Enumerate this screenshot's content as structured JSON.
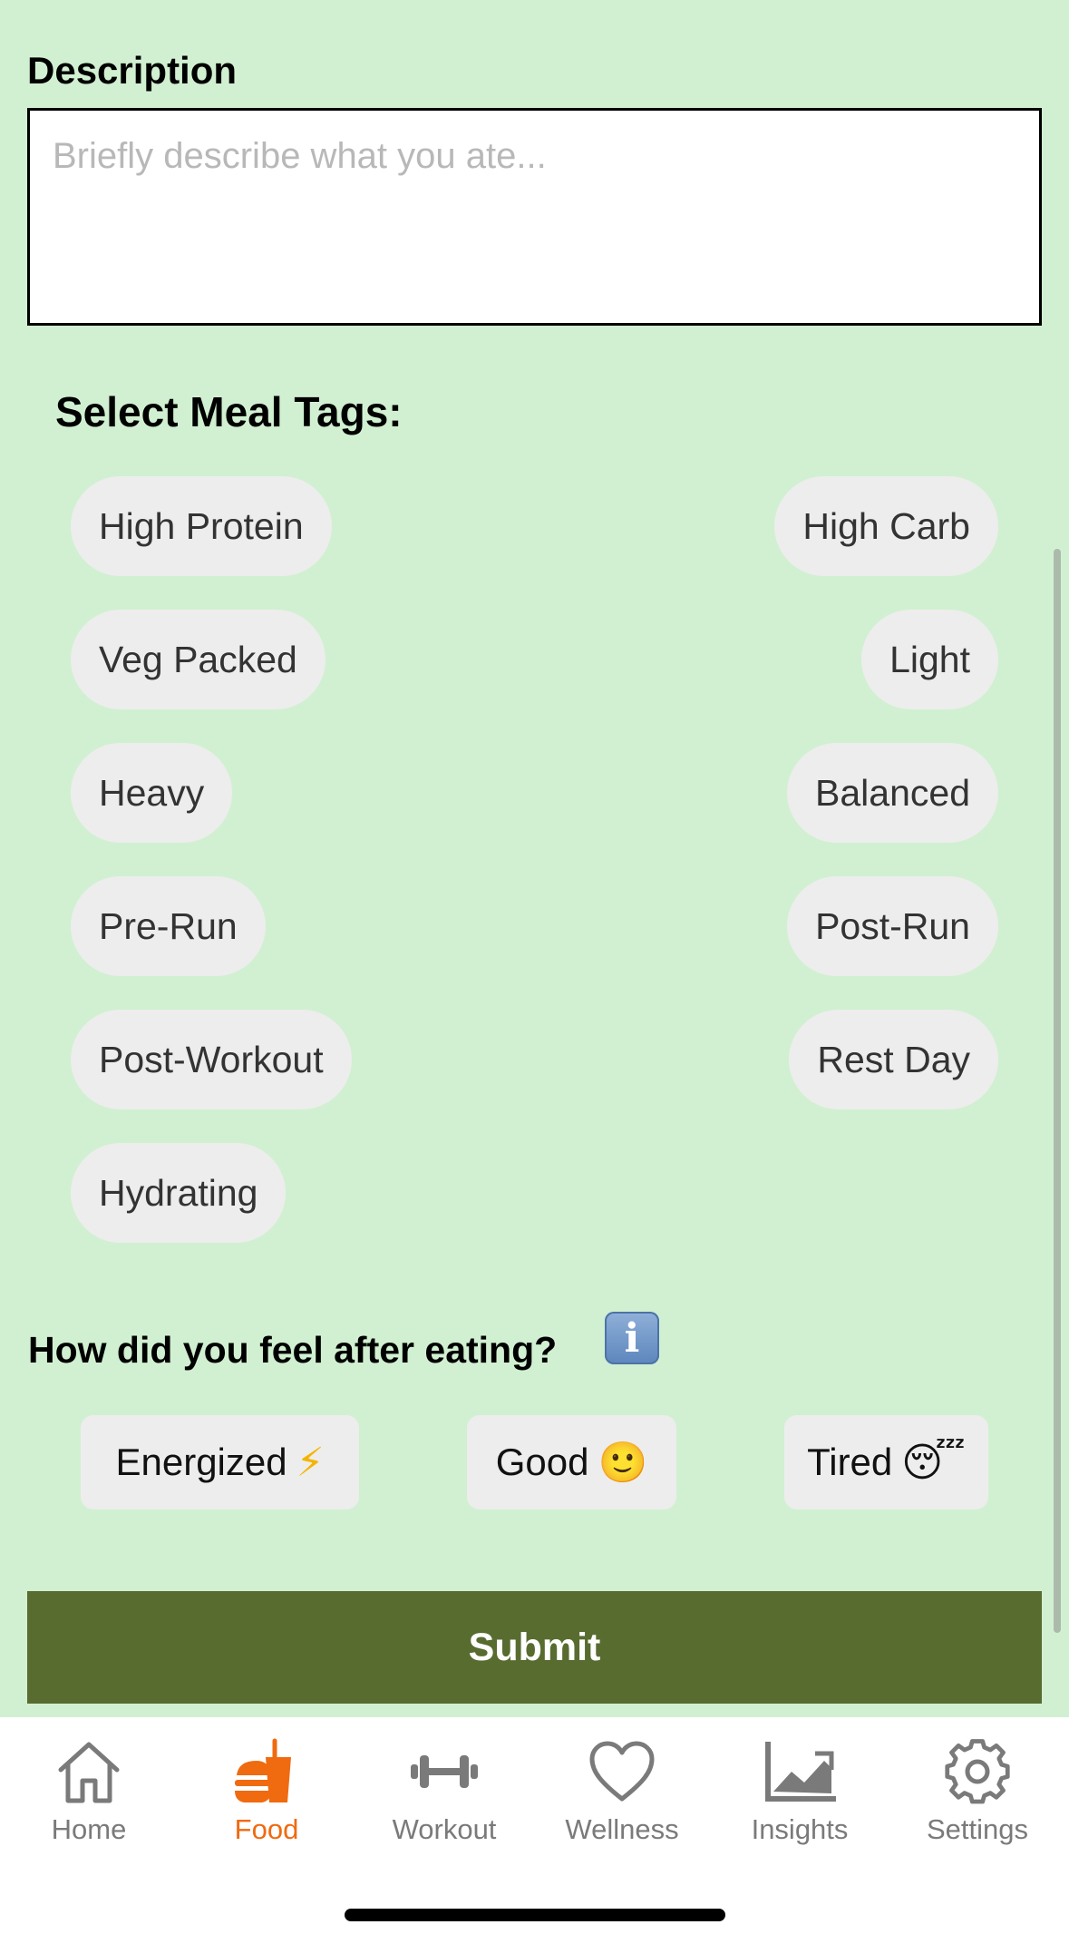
{
  "description": {
    "label": "Description",
    "placeholder": "Briefly describe what you ate..."
  },
  "meal_tags": {
    "label": "Select Meal Tags:",
    "tags": [
      "High Protein",
      "High Carb",
      "Veg Packed",
      "Light",
      "Heavy",
      "Balanced",
      "Pre-Run",
      "Post-Run",
      "Post-Workout",
      "Rest Day",
      "Hydrating"
    ]
  },
  "feeling": {
    "label": "How did you feel after eating?",
    "info_icon": "info-icon",
    "options": [
      {
        "label": "Energized",
        "emoji": "⚡"
      },
      {
        "label": "Good",
        "emoji": "🙂"
      },
      {
        "label": "Tired",
        "emoji": "😴"
      }
    ]
  },
  "submit_label": "Submit",
  "tabbar": {
    "active": "Food",
    "active_color": "#f06a10",
    "inactive_color": "#7a7a7a",
    "items": [
      {
        "label": "Home",
        "icon": "home-icon"
      },
      {
        "label": "Food",
        "icon": "food-icon"
      },
      {
        "label": "Workout",
        "icon": "dumbbell-icon"
      },
      {
        "label": "Wellness",
        "icon": "heart-icon"
      },
      {
        "label": "Insights",
        "icon": "chart-icon"
      },
      {
        "label": "Settings",
        "icon": "gear-icon"
      }
    ]
  },
  "colors": {
    "background": "#d1f0d1",
    "submit_background": "#586c30",
    "chip_background": "#ededed"
  }
}
